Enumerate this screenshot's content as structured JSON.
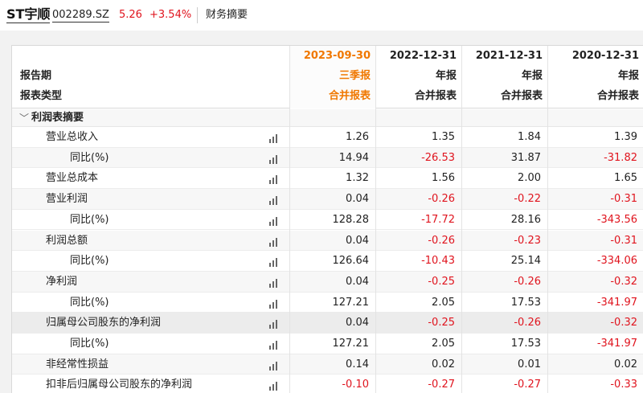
{
  "header": {
    "stock_name": "ST宇顺",
    "stock_code": "002289.SZ",
    "price": "5.26",
    "change": "+3.54%",
    "tab_label": "财务摘要"
  },
  "table": {
    "row_labels": {
      "period": "报告期",
      "report_name": "",
      "report_type": "报表类型"
    },
    "columns": [
      {
        "date": "2023-09-30",
        "report": "三季报",
        "type": "合并报表",
        "highlight": true
      },
      {
        "date": "2022-12-31",
        "report": "年报",
        "type": "合并报表",
        "highlight": false
      },
      {
        "date": "2021-12-31",
        "report": "年报",
        "type": "合并报表",
        "highlight": false
      },
      {
        "date": "2020-12-31",
        "report": "年报",
        "type": "合并报表",
        "highlight": false
      }
    ],
    "section_title": "利润表摘要",
    "rows": [
      {
        "label": "营业总收入",
        "level": 1,
        "values": [
          "1.26",
          "1.35",
          "1.84",
          "1.39"
        ]
      },
      {
        "label": "同比(%)",
        "level": 2,
        "values": [
          "14.94",
          "-26.53",
          "31.87",
          "-31.82"
        ]
      },
      {
        "label": "营业总成本",
        "level": 1,
        "values": [
          "1.32",
          "1.56",
          "2.00",
          "1.65"
        ]
      },
      {
        "label": "营业利润",
        "level": 1,
        "values": [
          "0.04",
          "-0.26",
          "-0.22",
          "-0.31"
        ]
      },
      {
        "label": "同比(%)",
        "level": 2,
        "values": [
          "128.28",
          "-17.72",
          "28.16",
          "-343.56"
        ]
      },
      {
        "label": "利润总额",
        "level": 1,
        "values": [
          "0.04",
          "-0.26",
          "-0.23",
          "-0.31"
        ]
      },
      {
        "label": "同比(%)",
        "level": 2,
        "values": [
          "126.64",
          "-10.43",
          "25.14",
          "-334.06"
        ]
      },
      {
        "label": "净利润",
        "level": 1,
        "values": [
          "0.04",
          "-0.25",
          "-0.26",
          "-0.32"
        ]
      },
      {
        "label": "同比(%)",
        "level": 2,
        "values": [
          "127.21",
          "2.05",
          "17.53",
          "-341.97"
        ]
      },
      {
        "label": "归属母公司股东的净利润",
        "level": 1,
        "values": [
          "0.04",
          "-0.25",
          "-0.26",
          "-0.32"
        ],
        "highlight": true
      },
      {
        "label": "同比(%)",
        "level": 2,
        "values": [
          "127.21",
          "2.05",
          "17.53",
          "-341.97"
        ]
      },
      {
        "label": "非经常性损益",
        "level": 1,
        "values": [
          "0.14",
          "0.02",
          "0.01",
          "0.02"
        ]
      },
      {
        "label": "扣非后归属母公司股东的净利润",
        "level": 1,
        "values": [
          "-0.10",
          "-0.27",
          "-0.27",
          "-0.33"
        ]
      }
    ]
  },
  "colors": {
    "negative": "#e0141e",
    "highlight_header": "#f07800",
    "price": "#e0141e"
  },
  "icons": {
    "chart_icon": "bar-chart-icon",
    "collapse_icon": "chevron-down-icon"
  }
}
